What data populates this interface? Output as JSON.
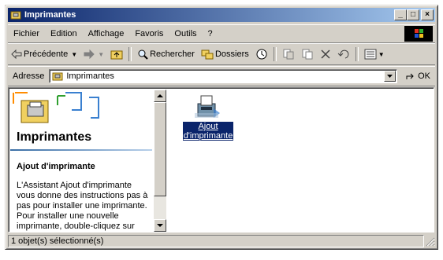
{
  "window": {
    "title": "Imprimantes"
  },
  "title_buttons": {
    "minimize": "_",
    "maximize": "□",
    "close": "×"
  },
  "menu": [
    "Fichier",
    "Edition",
    "Affichage",
    "Favoris",
    "Outils",
    "?"
  ],
  "toolbar": {
    "back": "Précédente",
    "search": "Rechercher",
    "folders": "Dossiers"
  },
  "address": {
    "label": "Adresse",
    "value": "Imprimantes",
    "go": "OK"
  },
  "left_pane": {
    "title": "Imprimantes",
    "subtitle": "Ajout d'imprimante",
    "description": "L'Assistant Ajout d'imprimante vous donne des instructions pas à pas pour installer une imprimante. Pour installer une nouvelle imprimante, double-cliquez sur l'icône Ajouter"
  },
  "items": [
    {
      "label_line1": "Ajout",
      "label_line2": "d'imprimante",
      "selected": true
    }
  ],
  "status": {
    "text": "1 objet(s) sélectionné(s)"
  },
  "colors": {
    "title_start": "#0a246a",
    "title_end": "#a6caf0",
    "selection": "#0a246a",
    "face": "#d4d0c8"
  }
}
